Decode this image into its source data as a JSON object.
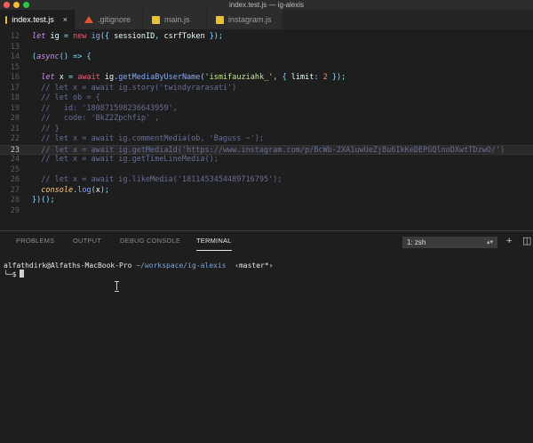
{
  "window": {
    "title": "index.test.js — ig-alexis"
  },
  "tabs": [
    {
      "label": "index.test.js",
      "close": "×",
      "icon": "js-file-icon",
      "active": true
    },
    {
      "label": ".gitignore",
      "icon": "git-file-icon"
    },
    {
      "label": "main.js",
      "icon": "js-file-icon"
    },
    {
      "label": "instagram.js",
      "icon": "js-file-icon"
    }
  ],
  "editor": {
    "current_line": "23",
    "lines": [
      {
        "n": "12",
        "tokens": [
          [
            "kw",
            "let"
          ],
          [
            "plain",
            " ig "
          ],
          [
            "punc",
            "="
          ],
          [
            "plain",
            " "
          ],
          [
            "red",
            "new"
          ],
          [
            "plain",
            " "
          ],
          [
            "fn",
            "ig"
          ],
          [
            "punc",
            "({"
          ],
          [
            "plain",
            " sessionID"
          ],
          [
            "punc",
            ","
          ],
          [
            "plain",
            " csrfToken "
          ],
          [
            "punc",
            "});"
          ]
        ]
      },
      {
        "n": "13",
        "tokens": []
      },
      {
        "n": "14",
        "tokens": [
          [
            "punc",
            "("
          ],
          [
            "kw",
            "async"
          ],
          [
            "punc",
            "() =>"
          ],
          [
            "plain",
            " "
          ],
          [
            "punc",
            "{"
          ]
        ]
      },
      {
        "n": "15",
        "tokens": []
      },
      {
        "n": "16",
        "tokens": [
          [
            "plain",
            "  "
          ],
          [
            "kw",
            "let"
          ],
          [
            "plain",
            " x "
          ],
          [
            "punc",
            "="
          ],
          [
            "plain",
            " "
          ],
          [
            "red",
            "await"
          ],
          [
            "plain",
            " ig"
          ],
          [
            "punc",
            "."
          ],
          [
            "fn",
            "getMediaByUserName"
          ],
          [
            "punc",
            "("
          ],
          [
            "str",
            "'ismifauziahk_'"
          ],
          [
            "punc",
            ","
          ],
          [
            "plain",
            " "
          ],
          [
            "punc",
            "{"
          ],
          [
            "plain",
            " limit"
          ],
          [
            "punc",
            ":"
          ],
          [
            "plain",
            " "
          ],
          [
            "num",
            "2"
          ],
          [
            "plain",
            " "
          ],
          [
            "punc",
            "});"
          ]
        ]
      },
      {
        "n": "17",
        "tokens": [
          [
            "cm",
            "  // let x = await ig.story('twindyrarasati')"
          ]
        ]
      },
      {
        "n": "18",
        "tokens": [
          [
            "cm",
            "  // let ob = {"
          ]
        ]
      },
      {
        "n": "19",
        "tokens": [
          [
            "cm",
            "  //   id: '180871598236643959',"
          ]
        ]
      },
      {
        "n": "20",
        "tokens": [
          [
            "cm",
            "  //   code: 'BkZ2Zpchfip' ,"
          ]
        ]
      },
      {
        "n": "21",
        "tokens": [
          [
            "cm",
            "  // }"
          ]
        ]
      },
      {
        "n": "22",
        "tokens": [
          [
            "cm",
            "  // let x = await ig.commentMedia(ob, 'Baguss ~');"
          ]
        ]
      },
      {
        "n": "23",
        "tokens": [
          [
            "cm",
            "  // let x = await ig.getMediaId('https://www.instagram.com/p/BcWb-2XA1uwUeZjBu6IkKeDEPGQlnoDXwtTDzwO/')"
          ]
        ]
      },
      {
        "n": "24",
        "tokens": [
          [
            "cm",
            "  // let x = await ig.getTimeLineMedia();"
          ]
        ]
      },
      {
        "n": "25",
        "tokens": []
      },
      {
        "n": "26",
        "tokens": [
          [
            "cm",
            "  // let x = await ig.likeMedia('1811453454489716795');"
          ]
        ]
      },
      {
        "n": "27",
        "tokens": [
          [
            "plain",
            "  "
          ],
          [
            "obj",
            "console"
          ],
          [
            "punc",
            "."
          ],
          [
            "fn",
            "log"
          ],
          [
            "punc",
            "("
          ],
          [
            "plain",
            "x"
          ],
          [
            "punc",
            ");"
          ]
        ]
      },
      {
        "n": "28",
        "tokens": [
          [
            "punc",
            "})();"
          ]
        ]
      },
      {
        "n": "29",
        "tokens": []
      }
    ]
  },
  "panel": {
    "tabs": [
      {
        "label": "PROBLEMS"
      },
      {
        "label": "OUTPUT"
      },
      {
        "label": "DEBUG CONSOLE"
      },
      {
        "label": "TERMINAL",
        "active": true
      }
    ],
    "terminal_select": "1: zsh",
    "select_arrow": "▴▾",
    "add_button": "+",
    "split_button": "◫"
  },
  "terminal": {
    "user": "alfathdirk@Alfaths-MacBook-Pro",
    "path": "~/workspace/ig-alexis",
    "branch": "‹master*›",
    "prompt": "╰─$"
  },
  "colors": {
    "accent": "#007acc",
    "background": "#1e1e1e",
    "tab_bar": "#252526"
  }
}
